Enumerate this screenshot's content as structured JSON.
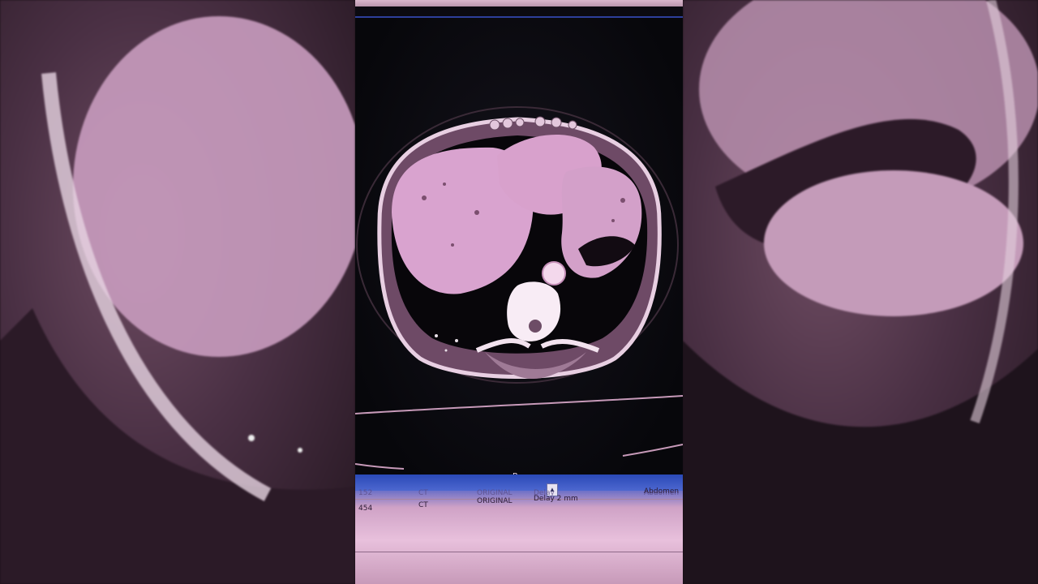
{
  "viewer": {
    "orientation_label": "P"
  },
  "table": {
    "headers": [
      "152",
      "CT",
      "ORIGINAL",
      "Delay",
      "Abdomen"
    ],
    "row": {
      "number": "454",
      "modality": "CT",
      "image_type": "ORIGINAL",
      "delay": "Delay 2 mm",
      "series": "Abdomen"
    }
  },
  "colors": {
    "accent_blue": "#2d3f9a",
    "tissue_pink": "#d9a3cf"
  }
}
